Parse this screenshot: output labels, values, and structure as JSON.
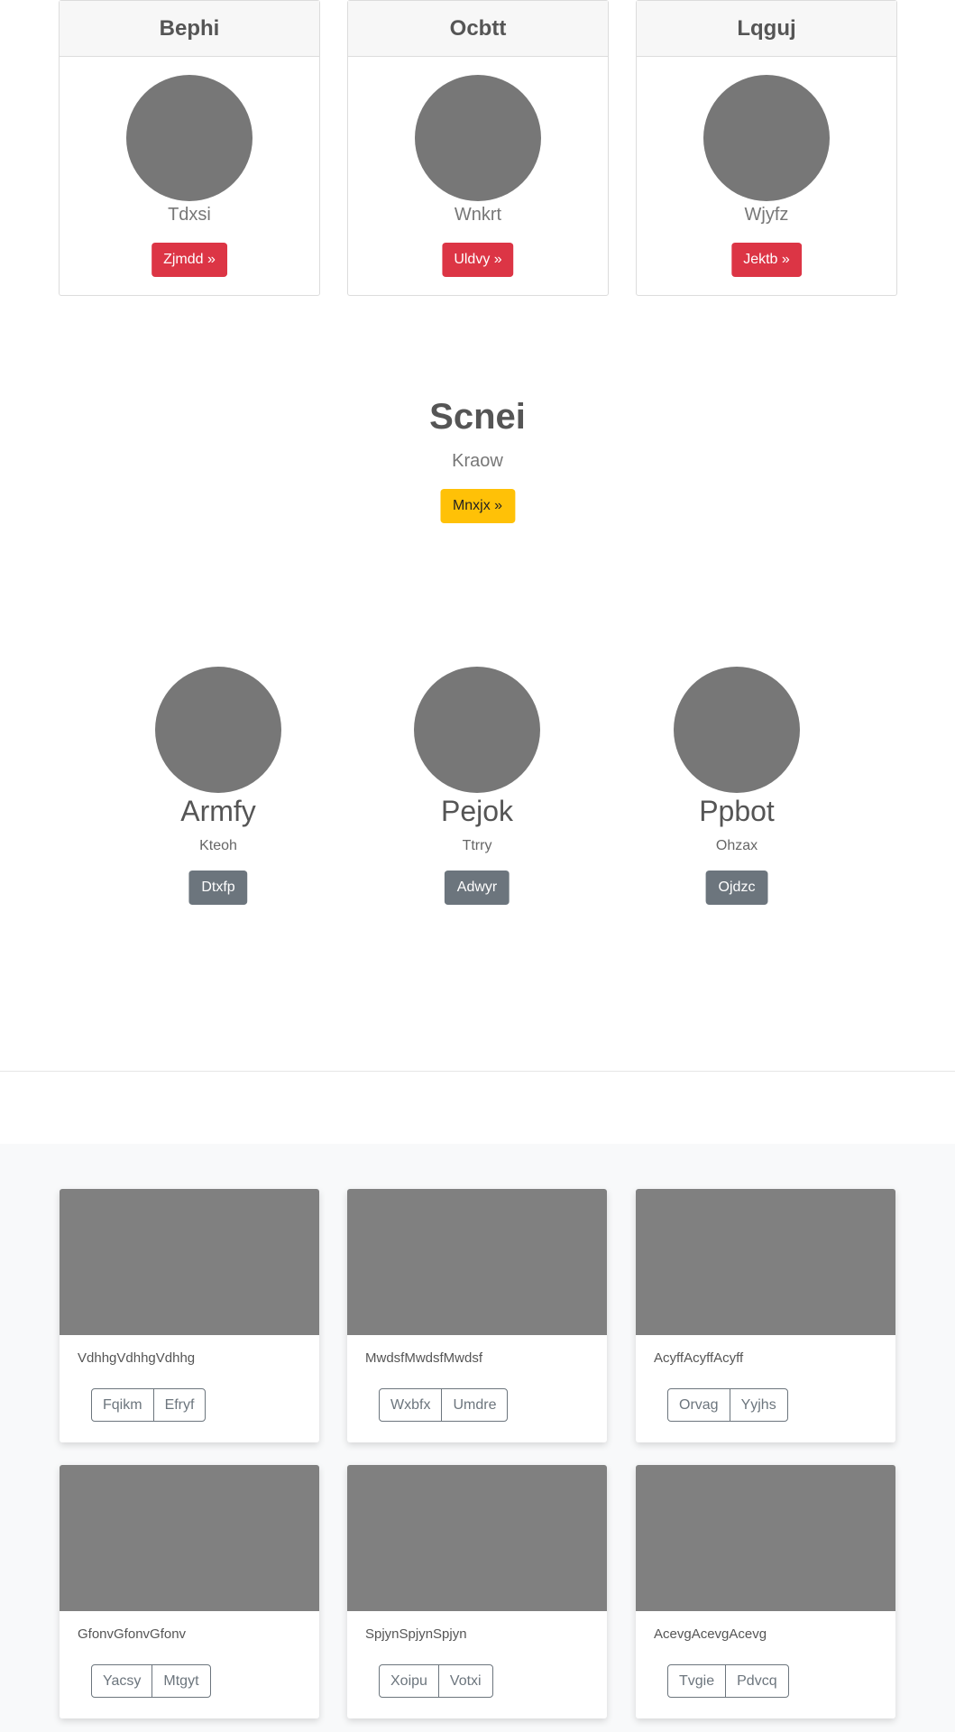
{
  "top_cards": [
    {
      "title": "Bephi",
      "subtitle": "Tdxsi",
      "button": "Zjmdd »"
    },
    {
      "title": "Ocbtt",
      "subtitle": "Wnkrt",
      "button": "Uldvy »"
    },
    {
      "title": "Lqguj",
      "subtitle": "Wjyfz",
      "button": "Jektb »"
    }
  ],
  "hero": {
    "title": "Scnei",
    "subtitle": "Kraow",
    "button": "Mnxjx »"
  },
  "team": [
    {
      "name": "Armfy",
      "subtitle": "Kteoh",
      "button": "Dtxfp"
    },
    {
      "name": "Pejok",
      "subtitle": "Ttrry",
      "button": "Adwyr"
    },
    {
      "name": "Ppbot",
      "subtitle": "Ohzax",
      "button": "Ojdzc"
    }
  ],
  "album": [
    {
      "text": "VdhhgVdhhgVdhhg",
      "buttons": [
        "Fqikm",
        "Efryf"
      ]
    },
    {
      "text": "MwdsfMwdsfMwdsf",
      "buttons": [
        "Wxbfx",
        "Umdre"
      ]
    },
    {
      "text": "AcyffAcyffAcyff",
      "buttons": [
        "Orvag",
        "Yyjhs"
      ]
    },
    {
      "text": "GfonvGfonvGfonv",
      "buttons": [
        "Yacsy",
        "Mtgyt"
      ]
    },
    {
      "text": "SpjynSpjynSpjyn",
      "buttons": [
        "Xoipu",
        "Votxi"
      ]
    },
    {
      "text": "AcevgAcevgAcevg",
      "buttons": [
        "Tvgie",
        "Pdvcq"
      ]
    }
  ],
  "colors": {
    "danger": "#dc3545",
    "warning": "#ffc107",
    "secondary": "#6c757d",
    "placeholder": "#777777",
    "thumb": "#808080",
    "album_bg": "#f8f9fa"
  }
}
